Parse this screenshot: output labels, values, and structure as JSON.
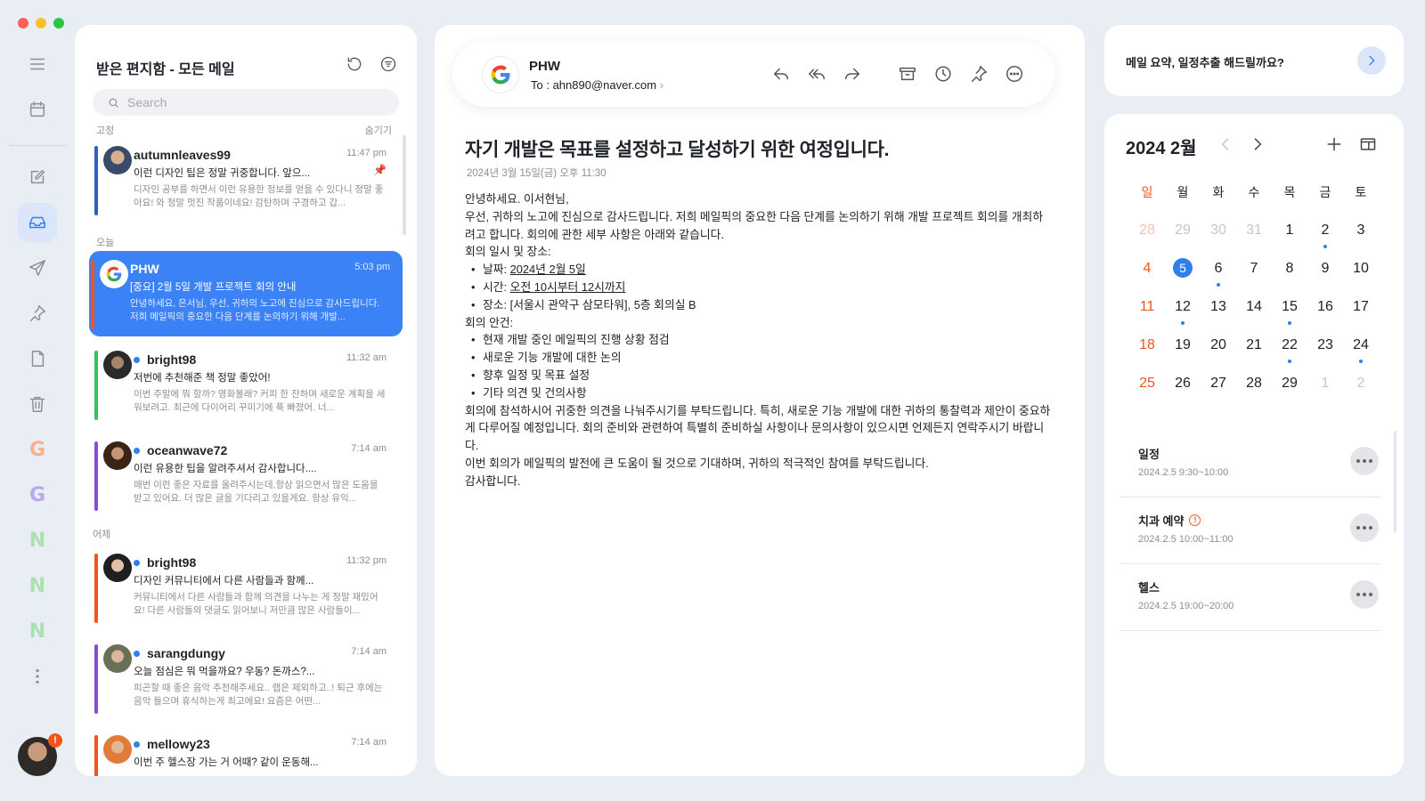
{
  "rail": {
    "icons": [
      "menu-icon",
      "calendar-icon",
      "compose-icon",
      "inbox-icon",
      "send-icon",
      "pin-icon",
      "draft-icon",
      "trash-icon"
    ],
    "accounts": [
      {
        "letter": "G",
        "color": "#f6b08e"
      },
      {
        "letter": "G",
        "color": "#b9a6f0"
      },
      {
        "letter": "N",
        "color": "#a9e2b0"
      },
      {
        "letter": "N",
        "color": "#a9e2b0"
      },
      {
        "letter": "N",
        "color": "#a9e2b0"
      }
    ],
    "profile_badge": "!"
  },
  "list": {
    "title": "받은 편지함 - 모든 메일",
    "search_placeholder": "Search",
    "section_pinned": "고정",
    "hide_label": "숨기기",
    "section_today": "오늘",
    "section_yesterday": "어제",
    "mails": [
      {
        "sender": "autumnleaves99",
        "time": "11:47 pm",
        "subject": "이런 디자인 팁은 정말 귀중합니다. 앞으...",
        "preview": "디자인 공부를 하면서 이런 유용한 정보를 얻을 수 있다니 정말 좋아요! 와 정말 멋진 작품이네요! 감탄하며 구경하고 갑...",
        "bar": "#2f5fc4",
        "unread": false
      },
      {
        "sender": "PHW",
        "time": "5:03 pm",
        "subject": "[중요] 2월 5일 개발 프로젝트 회의 안내",
        "preview": "안녕하세요, 은서님, 우선, 귀하의 노고에 진심으로 감사드립니다. 저희 메일픽의 중요한 다음 단계를 논의하기 위해 개발...",
        "bar": "#f2541b",
        "unread": false
      },
      {
        "sender": "bright98",
        "time": "11:32 am",
        "subject": "저번에 추천해준 책 정말 좋았어!",
        "preview": "이번 주말에 뭐 할까? 영화볼래? 커피 한 잔하며 새로운 계획을 세워보려고. 최근에 다이어리 꾸미기에 푹 빠졌어. 너...",
        "bar": "#36c25a",
        "unread": true
      },
      {
        "sender": "oceanwave72",
        "time": "7:14 am",
        "subject": "이런 유용한 팁을 알려주셔서 감사합니다....",
        "preview": "매번 이런 좋은 자료를 올려주시는데,항상 읽으면서 많은 도움을 받고 있어요. 더 많은 글을 기다리고 있을게요. 항상 유익...",
        "bar": "#8a4bd8",
        "unread": true
      },
      {
        "sender": "bright98",
        "time": "11:32 pm",
        "subject": "디자인 커뮤니티에서 다른 사람들과 함께...",
        "preview": "커뮤니티에서 다른 사람들과 함께 의견을 나누는 게 정말 재밌어요! 다른 사람들의 댓글도 읽어보니 저만큼 많은 사람들이...",
        "bar": "#f2541b",
        "unread": true
      },
      {
        "sender": "sarangdungy",
        "time": "7:14 am",
        "subject": "오늘 점심은 뭐 먹을까요? 우동? 돈까스?...",
        "preview": "피곤할 때 좋은 음악 추천해주세요.. 랩은 제외하고..! 퇴근 후에는 음악 들으며 휴식하는게 최고에요! 요즘은 어떤...",
        "bar": "#8a4bd8",
        "unread": true
      },
      {
        "sender": "mellowy23",
        "time": "7:14 am",
        "subject": "이번 주 헬스장 가는 거 어때? 같이 운동해...",
        "preview": "",
        "bar": "#f2541b",
        "unread": true
      }
    ]
  },
  "reader": {
    "from": "PHW",
    "to": "To : ahn890@naver.com",
    "subject": "자기 개발은 목표를 설정하고 달성하기 위한 여정입니다.",
    "date": "2024년 3월 15일(금) 오후 11:30",
    "greeting": "안녕하세요. 이서현님,",
    "p1": "우선, 귀하의 노고에 진심으로 감사드립니다. 저희 메일픽의 중요한 다음 단계를 논의하기 위해 개발 프로젝트 회의를 개최하려고 합니다. 회의에 관한 세부 사항은 아래와 같습니다.",
    "info_title": "회의 일시 및 장소:",
    "date_label": "날짜: ",
    "date_value": "2024년 2월 5일",
    "time_label": "시간: ",
    "time_value": "오전 10시부터 12시까지",
    "place": "장소: [서울시 관악구 삼모타워], 5층 회의실 B",
    "agenda_title": "회의 안건:",
    "agenda": [
      "현재 개발 중인 메일픽의 진행 상황 점검",
      "새로운 기능 개발에 대한 논의",
      "향후 일정 및 목표 설정",
      "기타 의견 및 건의사항"
    ],
    "p2": "회의에 참석하시어 귀중한 의견을 나눠주시기를 부탁드립니다. 특히, 새로운 기능 개발에 대한 귀하의 통찰력과 제안이 중요하게 다루어질 예정입니다. 회의 준비와 관련하여 특별히 준비하실 사항이나 문의사항이 있으시면 언제든지 연락주시기 바랍니다.",
    "p3": "이번 회의가 메일픽의 발전에 큰 도움이 될 것으로 기대하며, 귀하의 적극적인 참여를 부탁드립니다.",
    "closing": "감사합니다."
  },
  "assistant": {
    "prompt": "메일 요약, 일정추출 해드릴까요?"
  },
  "calendar": {
    "title": "2024 2월",
    "weekdays": [
      "일",
      "월",
      "화",
      "수",
      "목",
      "금",
      "토"
    ],
    "weeks": [
      [
        {
          "d": "28",
          "dim": true
        },
        {
          "d": "29",
          "dim": true
        },
        {
          "d": "30",
          "dim": true
        },
        {
          "d": "31",
          "dim": true
        },
        {
          "d": "1"
        },
        {
          "d": "2",
          "dot": true
        },
        {
          "d": "3"
        }
      ],
      [
        {
          "d": "4"
        },
        {
          "d": "5",
          "today": true
        },
        {
          "d": "6",
          "dot": true
        },
        {
          "d": "7"
        },
        {
          "d": "8"
        },
        {
          "d": "9"
        },
        {
          "d": "10"
        }
      ],
      [
        {
          "d": "11"
        },
        {
          "d": "12",
          "dot": true
        },
        {
          "d": "13"
        },
        {
          "d": "14"
        },
        {
          "d": "15",
          "dot": true
        },
        {
          "d": "16"
        },
        {
          "d": "17"
        }
      ],
      [
        {
          "d": "18"
        },
        {
          "d": "19"
        },
        {
          "d": "20"
        },
        {
          "d": "21"
        },
        {
          "d": "22",
          "dot": true
        },
        {
          "d": "23"
        },
        {
          "d": "24",
          "dot": true
        }
      ],
      [
        {
          "d": "25"
        },
        {
          "d": "26"
        },
        {
          "d": "27"
        },
        {
          "d": "28"
        },
        {
          "d": "29"
        },
        {
          "d": "1",
          "dim": true
        },
        {
          "d": "2",
          "dim": true
        }
      ]
    ],
    "events": [
      {
        "name": "일정",
        "when": "2024.2.5 9:30~10:00",
        "warn": false
      },
      {
        "name": "치과 예약",
        "when": "2024.2.5 10:00~11:00",
        "warn": true
      },
      {
        "name": "헬스",
        "when": "2024.2.5 19:00~20:00",
        "warn": false
      }
    ]
  },
  "colors": {
    "accent": "#2f80ed",
    "selected_mail": "#3b82f6",
    "warning": "#f2541b"
  }
}
